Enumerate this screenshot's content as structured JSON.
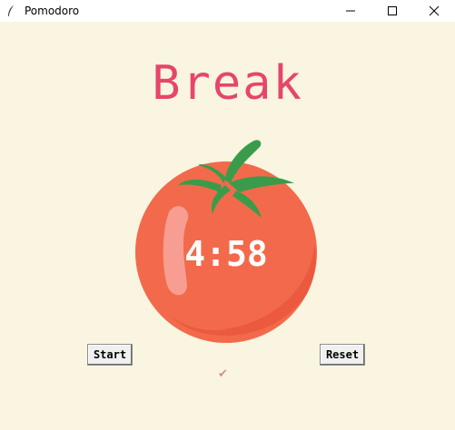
{
  "window": {
    "title": "Pomodoro",
    "icon": "feather-icon",
    "controls": [
      "minimize-icon",
      "maximize-icon",
      "close-icon"
    ]
  },
  "main": {
    "heading": "Break",
    "timer": "4:58",
    "start_label": "Start",
    "reset_label": "Reset",
    "checkmarks": "✔"
  },
  "colors": {
    "background": "#f9f5e0",
    "heading": "#e6466b",
    "tomato": "#f26a4b",
    "leaf": "#3a9c4a"
  }
}
